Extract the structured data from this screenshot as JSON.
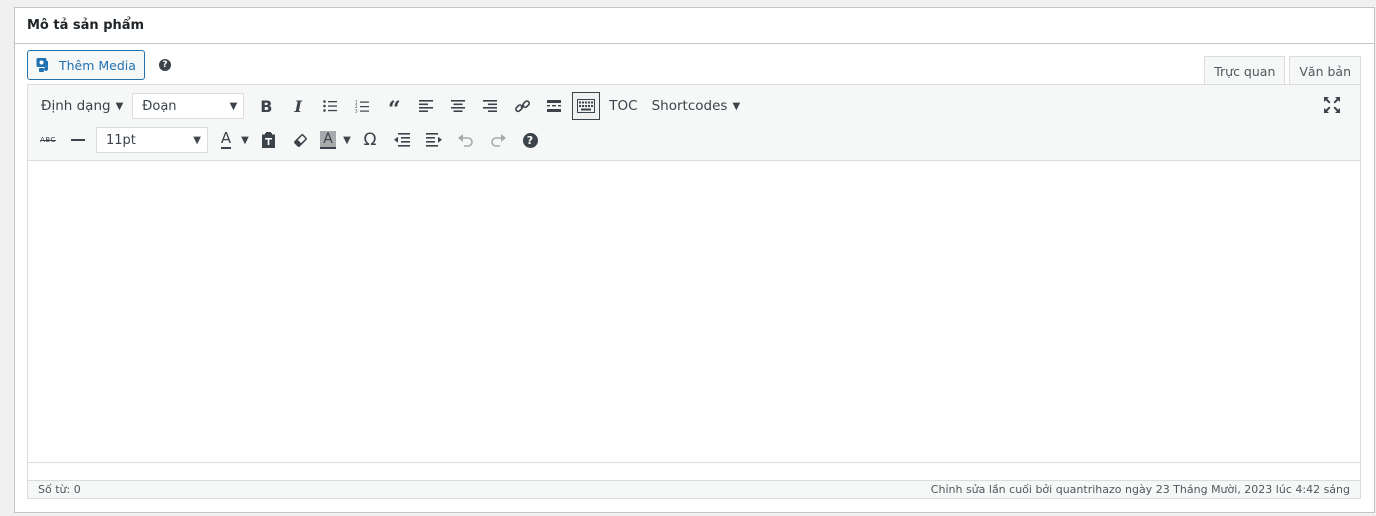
{
  "panel": {
    "title": "Mô tả sản phẩm"
  },
  "media": {
    "add_label": "Thêm Media",
    "help_icon": "question-circle-icon"
  },
  "tabs": [
    {
      "label": "Trực quan",
      "active": true
    },
    {
      "label": "Văn bản",
      "active": false
    }
  ],
  "toolbar": {
    "format_label": "Định dạng",
    "paragraph_value": "Đoạn",
    "toc_label": "TOC",
    "shortcodes_label": "Shortcodes",
    "fontsize_value": "11pt",
    "text_color_letter": "A",
    "bg_color_letter": "A",
    "special_char": "Ω",
    "strikethrough_glyph": "ABC",
    "icons": [
      "bold-icon",
      "italic-icon",
      "bulleted-list-icon",
      "numbered-list-icon",
      "blockquote-icon",
      "align-left-icon",
      "align-center-icon",
      "align-right-icon",
      "link-icon",
      "read-more-icon",
      "toolbar-toggle-icon",
      "fullscreen-icon",
      "strikethrough-icon",
      "horizontal-line-icon",
      "paste-text-icon",
      "clear-formatting-icon",
      "special-character-icon",
      "outdent-icon",
      "indent-icon",
      "undo-icon",
      "redo-icon",
      "help-icon"
    ]
  },
  "status": {
    "word_count": "Số từ: 0",
    "last_edit": "Chỉnh sửa lần cuối bởi quantrihazo ngày 23 Tháng Mười, 2023 lúc 4:42 sáng"
  },
  "colors": {
    "accent": "#2271b1",
    "text": "#1d2327",
    "icon": "#3c434a",
    "border": "#c3c4c7",
    "toolbar_bg": "#f6f7f7"
  }
}
